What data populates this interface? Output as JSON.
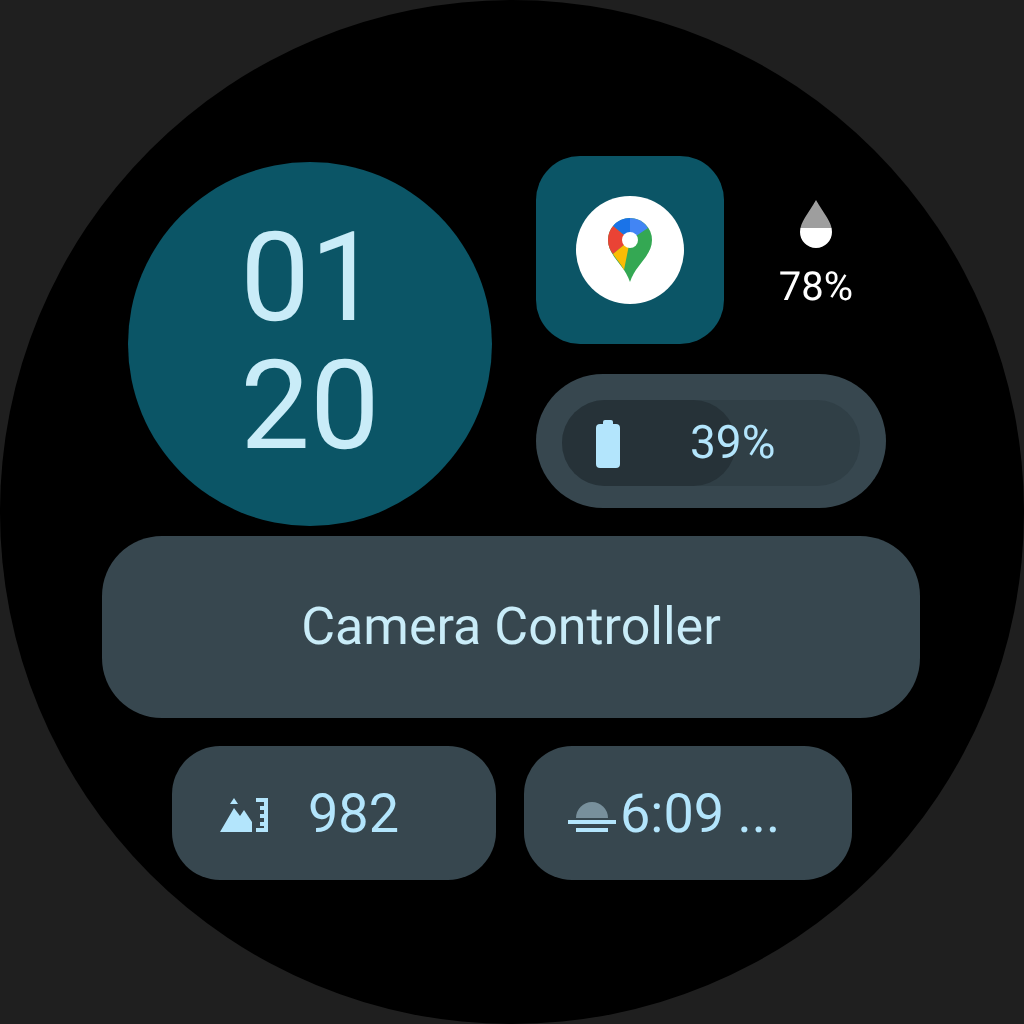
{
  "clock": {
    "hour": "01",
    "minute": "20"
  },
  "app_shortcut": {
    "kind": "maps"
  },
  "humidity": {
    "value": "78%"
  },
  "battery": {
    "value": "39%"
  },
  "app_launcher": {
    "label": "Camera Controller"
  },
  "bottom_complications": [
    {
      "kind": "elevation",
      "value": "982"
    },
    {
      "kind": "sunrise",
      "value": "6:09 ..."
    }
  ]
}
